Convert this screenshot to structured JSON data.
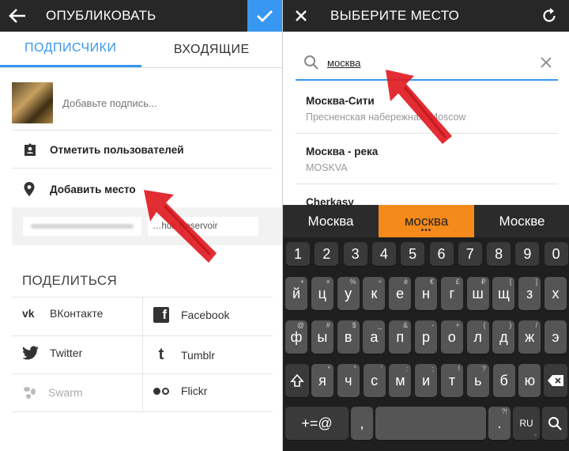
{
  "left": {
    "header": {
      "title": "ОПУБЛИКОВАТЬ"
    },
    "tabs": [
      {
        "label": "ПОДПИСЧИКИ"
      },
      {
        "label": "ВХОДЯЩИЕ"
      }
    ],
    "caption": {
      "placeholder": "Добавьте подпись..."
    },
    "tag_people": {
      "label": "Отметить пользователей"
    },
    "add_location": {
      "label": "Добавить место"
    },
    "suggestion_chip": {
      "label": "…huk Reservoir"
    },
    "share_heading": "ПОДЕЛИТЬСЯ",
    "share": [
      {
        "label": "ВКонтакте",
        "icon": "vk-icon"
      },
      {
        "label": "Facebook",
        "icon": "facebook-icon"
      },
      {
        "label": "Twitter",
        "icon": "twitter-icon"
      },
      {
        "label": "Tumblr",
        "icon": "tumblr-icon"
      },
      {
        "label": "Swarm",
        "icon": "swarm-icon"
      },
      {
        "label": "Flickr",
        "icon": "flickr-icon"
      }
    ],
    "colors": {
      "accent": "#3897f0",
      "confirm": "#3897f0",
      "arrow": "#e01b22"
    }
  },
  "right": {
    "header": {
      "title": "ВЫБЕРИТЕ МЕСТО"
    },
    "search": {
      "value": "москва"
    },
    "results": [
      {
        "name": "Москва-Сити",
        "sub": "Пресненская набережная, Moscow"
      },
      {
        "name": "Москва - река",
        "sub": "MOSKVA"
      },
      {
        "name": "Cherkasy",
        "sub": ""
      }
    ],
    "keyboard": {
      "suggestions": [
        "Москва",
        "москва",
        "Москве"
      ],
      "numbers": [
        "1",
        "2",
        "3",
        "4",
        "5",
        "6",
        "7",
        "8",
        "9",
        "0"
      ],
      "row1": [
        {
          "k": "й",
          "h": "+"
        },
        {
          "k": "ц",
          "h": "×"
        },
        {
          "k": "у",
          "h": "%"
        },
        {
          "k": "к",
          "h": "÷"
        },
        {
          "k": "е",
          "h": "ё"
        },
        {
          "k": "н",
          "h": "€"
        },
        {
          "k": "г",
          "h": "£"
        },
        {
          "k": "ш",
          "h": "₽"
        },
        {
          "k": "щ",
          "h": "["
        },
        {
          "k": "з",
          "h": "]"
        },
        {
          "k": "х",
          "h": ""
        }
      ],
      "row2": [
        {
          "k": "ф",
          "h": "@"
        },
        {
          "k": "ы",
          "h": "#"
        },
        {
          "k": "в",
          "h": "$"
        },
        {
          "k": "а",
          "h": "_"
        },
        {
          "k": "п",
          "h": "&"
        },
        {
          "k": "р",
          "h": "-"
        },
        {
          "k": "о",
          "h": "+"
        },
        {
          "k": "л",
          "h": "("
        },
        {
          "k": "д",
          "h": ")"
        },
        {
          "k": "ж",
          "h": "/"
        },
        {
          "k": "э",
          "h": ""
        }
      ],
      "row3": [
        {
          "k": "я",
          "h": "*"
        },
        {
          "k": "ч",
          "h": "\""
        },
        {
          "k": "с",
          "h": "'"
        },
        {
          "k": "м",
          "h": ":"
        },
        {
          "k": "и",
          "h": ";"
        },
        {
          "k": "т",
          "h": "!"
        },
        {
          "k": "ь",
          "h": "?"
        },
        {
          "k": "б",
          "h": ""
        },
        {
          "k": "ю",
          "h": ""
        }
      ],
      "symbols": "+=@",
      "comma": ",",
      "period": ".",
      "period_hint": "?!",
      "lang": "RU"
    }
  }
}
